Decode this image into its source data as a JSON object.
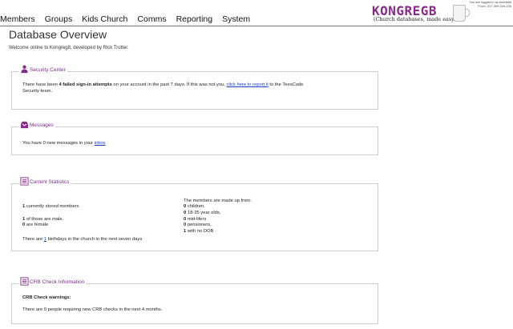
{
  "nav": [
    "Members",
    "Groups",
    "Kids Church",
    "Comms",
    "Reporting",
    "System"
  ],
  "logo": {
    "title": "KONGREGB",
    "tagline": "(Church databases, made easy)"
  },
  "login_info": {
    "line1": "You are logged in as Administ",
    "line2": "From: 217.200.224.226"
  },
  "page": {
    "title": "Database Overview",
    "welcome": "Welcome online to Kongreg8, developed by Rick Trotter."
  },
  "security": {
    "title": "Security Center",
    "icon": "user-lock-icon",
    "pre": "There have been ",
    "count_text": "4 failed sign-in attempts",
    "mid": " on your account in the past 7 days. If this was not you, ",
    "link": "click here to report it",
    "post": " to the TeesCode",
    "line2": "Security team."
  },
  "messages": {
    "title": "Messages",
    "icon": "inbox-icon",
    "pre": "You have 0 new messages in your ",
    "link": "inbox"
  },
  "stats": {
    "title": "Current Statistics",
    "icon": "list-icon",
    "stored_num": "1",
    "stored_text": " currently stored members",
    "male_num": "1",
    "male_text": " of those are male,",
    "female_num": "0",
    "female_text": " are female",
    "made_up": "The members are made up from:",
    "children_num": "0",
    "children_text": " children,",
    "young_num": "0",
    "young_text": " 18-35 year olds,",
    "mid_num": "0",
    "mid_text": " mid-lifers",
    "pens_num": "0",
    "pens_text": " pensioners.",
    "nodob_num": "1",
    "nodob_text": " with no DOB",
    "bday_pre": "There are ",
    "bday_link": "1",
    "bday_post": " birthdays in the church in the next seven days"
  },
  "crb": {
    "title": "CRB Check Information",
    "icon": "list-icon",
    "warn_title": "CRB Check warnings:",
    "warn_text": "There are 0 people requiring new CRB checks in the next 4 months."
  },
  "colors": {
    "accent": "#7b2a8a",
    "link": "#1a3ccc"
  }
}
